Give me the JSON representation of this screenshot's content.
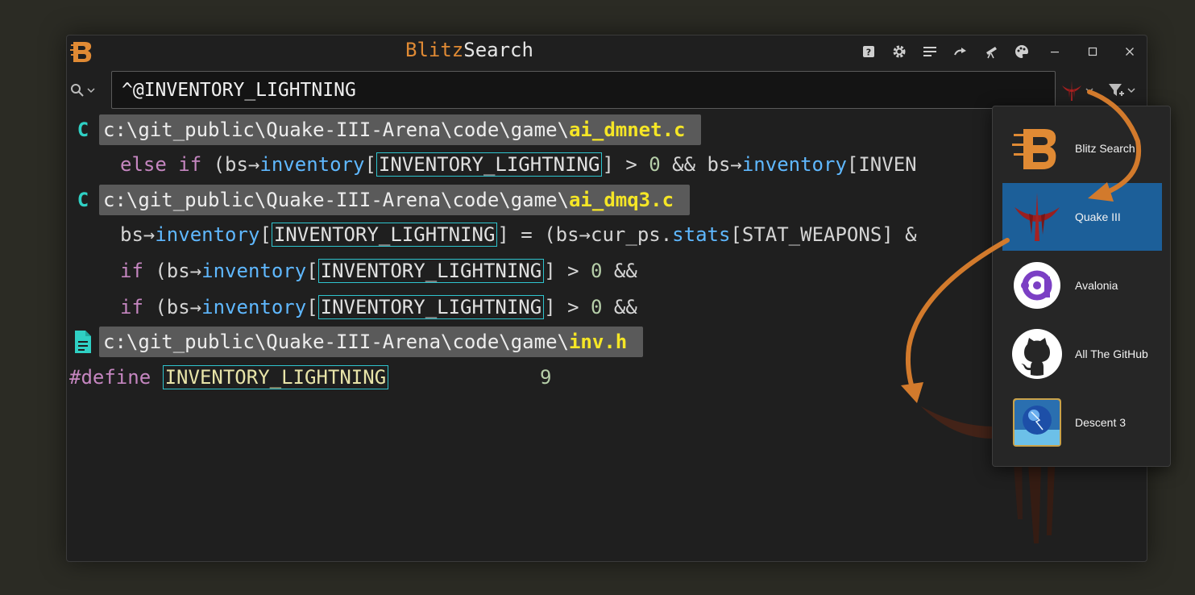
{
  "window": {
    "title_brand": "Blitz",
    "title_rest": "Search"
  },
  "search": {
    "query": "^@INVENTORY_LIGHTNING"
  },
  "results": {
    "files": [
      {
        "path": "c:\\git_public\\Quake-III-Arena\\code\\game\\",
        "name": "ai_dmnet.c",
        "icon": "c-file-icon"
      },
      {
        "path": "c:\\git_public\\Quake-III-Arena\\code\\game\\",
        "name": "ai_dmq3.c",
        "icon": "c-file-icon"
      },
      {
        "path": "c:\\git_public\\Quake-III-Arena\\code\\game\\",
        "name": "inv.h",
        "icon": "document-icon"
      }
    ],
    "lines": {
      "l1": {
        "else": "else",
        "if": "if",
        "a": " (bs",
        "arrow": "→",
        "inv": "inventory",
        "br": "[",
        "match": "INVENTORY_LIGHTNING",
        "b": "] > ",
        "zero": "0",
        "c": " && bs",
        "arrow2": "→",
        "inv2": "inventory",
        "d": "[INVEN"
      },
      "l2": {
        "a": "bs",
        "arrow": "→",
        "inv": "inventory",
        "br": "[",
        "match": "INVENTORY_LIGHTNING",
        "b": "] = (bs",
        "arrow2": "→",
        "c": "cur_ps.",
        "stats": "stats",
        "d": "[STAT_WEAPONS] &"
      },
      "l3": {
        "if": "if",
        "a": " (bs",
        "arrow": "→",
        "inv": "inventory",
        "br": "[",
        "match": "INVENTORY_LIGHTNING",
        "b": "] > ",
        "zero": "0",
        "c": " &&"
      },
      "l4": {
        "if": "if",
        "a": " (bs",
        "arrow": "→",
        "inv": "inventory",
        "br": "[",
        "match": "INVENTORY_LIGHTNING",
        "b": "] > ",
        "zero": "0",
        "c": " &&"
      },
      "l5": {
        "define": "#define",
        "sp": " ",
        "match": "INVENTORY_LIGHTNING",
        "pad": "             ",
        "nine": "9"
      }
    }
  },
  "projects": {
    "items": [
      {
        "label": "Blitz Search",
        "icon": "blitz-logo-icon"
      },
      {
        "label": "Quake III",
        "icon": "quake3-logo-icon",
        "selected": true
      },
      {
        "label": "Avalonia",
        "icon": "avalonia-logo-icon"
      },
      {
        "label": "All The GitHub",
        "icon": "github-logo-icon"
      },
      {
        "label": "Descent 3",
        "icon": "descent3-logo-icon"
      }
    ]
  },
  "colors": {
    "brand": "#e08a34",
    "match_border": "#2ec4ce",
    "filename": "#f5e626",
    "selected": "#1c5f99",
    "arrow": "#d27a2c"
  }
}
